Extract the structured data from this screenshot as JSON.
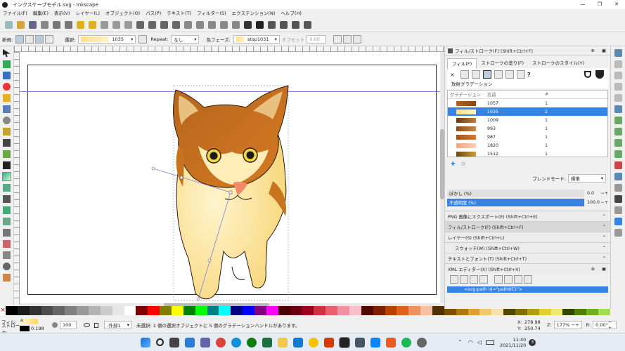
{
  "window": {
    "title": "インクスケープモデル.svg - Inkscape",
    "min": "—",
    "max": "❐",
    "close": "✕"
  },
  "menu": [
    "ファイル(F)",
    "編集(E)",
    "表示(V)",
    "レイヤー(L)",
    "オブジェクト(O)",
    "パス(P)",
    "テキスト(T)",
    "フィルター(S)",
    "エクステンション(N)",
    "ヘルプ(H)"
  ],
  "ctrl": {
    "new_label": "新規:",
    "select_label": "選択:",
    "select_value": "1035",
    "repeat_label": "Repeat:",
    "repeat_value": "なし",
    "stop_label": "色フェーズ:",
    "stop_value": "stop1031",
    "offset_label": "オフセット",
    "offset_value": "0.00"
  },
  "dock": {
    "title": "フィル/ストローク(F) (Shift+Ctrl+F)",
    "tabs": [
      "フィル(F)",
      "ストロークの塗り(F)",
      "ストロークのスタイル(Y)"
    ],
    "paint_unset": "×",
    "paint_unknown": "?",
    "gradient_title": "放射グラデーション",
    "col_gradient": "グラデーション",
    "col_name": "名前",
    "col_count": "#",
    "gradients": [
      {
        "name": "1057",
        "count": "1",
        "color_a": "#b5651d",
        "color_b": "#8a4410"
      },
      {
        "name": "1035",
        "count": "2",
        "color_a": "#ffe08a",
        "color_b": "#fff2c8"
      },
      {
        "name": "1009",
        "count": "1",
        "color_a": "#6b3a12",
        "color_b": "#c08040"
      },
      {
        "name": "993",
        "count": "1",
        "color_a": "#8a4a1a",
        "color_b": "#c8884a"
      },
      {
        "name": "987",
        "count": "1",
        "color_a": "#a0521c",
        "color_b": "#d87a30"
      },
      {
        "name": "1820",
        "count": "1",
        "color_a": "#f0a880",
        "color_b": "#f8d0b8"
      },
      {
        "name": "1512",
        "count": "1",
        "color_a": "#6a4a10",
        "color_b": "#c8a040"
      }
    ],
    "blend_label": "ブレンドモード:",
    "blend_value": "標準",
    "blur_label": "ぼかし (%)",
    "blur_value": "0.0",
    "opacity_label": "不透明度 (%)",
    "opacity_value": "100.0",
    "opacity_level": 100,
    "sections": [
      "PNG 画像にエクスポート(E) (Shift+Ctrl+E)",
      "フィル/ストローク(F) (Shift+Ctrl+F)",
      "レイヤー(S) (Shift+Ctrl+L)",
      "スウォッチ(W) (Shift+Ctrl+W)",
      "テキストとフォント(T) (Shift+Ctrl+T)",
      "XML エディター(X) (Shift+Ctrl+X)"
    ],
    "xml_line": "<svg:path id=\"path851\">"
  },
  "status": {
    "fill_label": "フィル:",
    "fill_value": "R",
    "stroke_label": "ストローク:",
    "stroke_width": "0.198",
    "opacity_box": "100",
    "layer": "-外部1",
    "message": "未選択: 1 個の選択オブジェクトに 5 個のグラデーションハンドルがあります。",
    "x_label": "X:",
    "x_value": "278.98",
    "y_label": "Y:",
    "y_value": "250.74",
    "z_label": "Z:",
    "zoom": "177%",
    "r_label": "R:",
    "rotation": "0.00°"
  },
  "taskbar": {
    "time": "11:40",
    "date": "2021/11/20",
    "notif": "3"
  },
  "colors": {
    "accent": "#3584e4"
  }
}
